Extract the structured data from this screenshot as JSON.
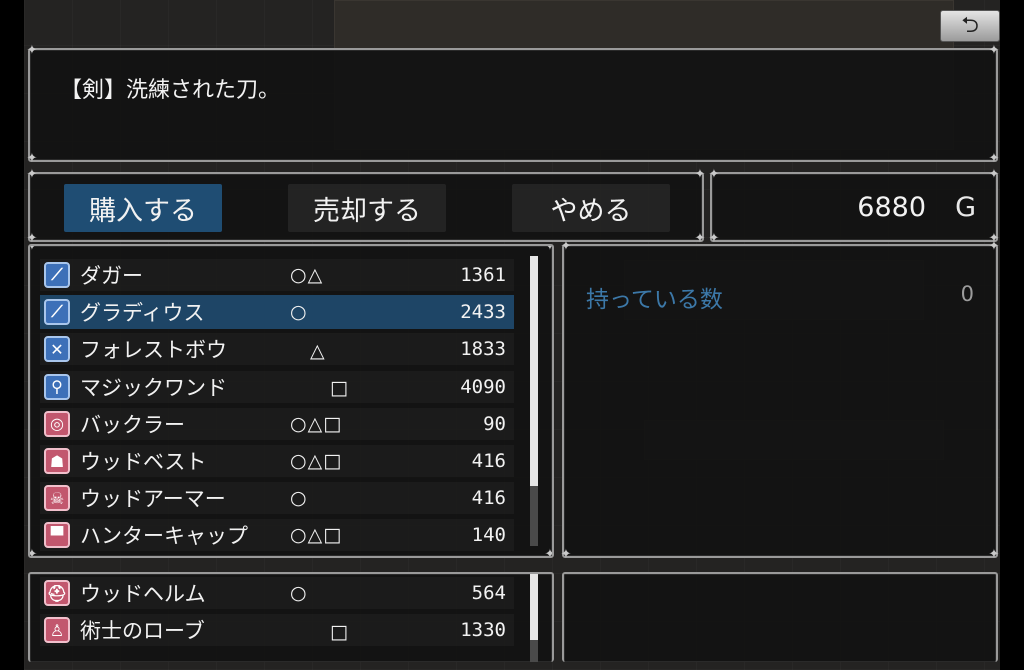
{
  "help": {
    "text": "【剣】洗練された刀。"
  },
  "commands": [
    {
      "label": "購入する"
    },
    {
      "label": "売却する"
    },
    {
      "label": "やめる"
    }
  ],
  "gold": {
    "amount": "6880",
    "unit": "G"
  },
  "items": [
    {
      "name": "ダガー",
      "marks": "○△",
      "price": "1361",
      "icon": "dagger-icon"
    },
    {
      "name": "グラディウス",
      "marks": "○",
      "price": "2433",
      "icon": "sword-icon"
    },
    {
      "name": "フォレストボウ",
      "marks": "　△",
      "price": "1833",
      "icon": "bow-icon"
    },
    {
      "name": "マジックワンド",
      "marks": "　　□",
      "price": "4090",
      "icon": "wand-icon"
    },
    {
      "name": "バックラー",
      "marks": "○△□",
      "price": "90",
      "icon": "shield-icon"
    },
    {
      "name": "ウッドベスト",
      "marks": "○△□",
      "price": "416",
      "icon": "vest-icon"
    },
    {
      "name": "ウッドアーマー",
      "marks": "○",
      "price": "416",
      "icon": "armor-icon"
    },
    {
      "name": "ハンターキャップ",
      "marks": "○△□",
      "price": "140",
      "icon": "cap-icon"
    },
    {
      "name": "ウッドヘルム",
      "marks": "○",
      "price": "564",
      "icon": "helm-icon"
    },
    {
      "name": "術士のローブ",
      "marks": "　　□",
      "price": "1330",
      "icon": "robe-icon"
    }
  ],
  "status": {
    "label": "持っている数",
    "value": "0"
  },
  "back": {
    "glyph": "⮌"
  }
}
